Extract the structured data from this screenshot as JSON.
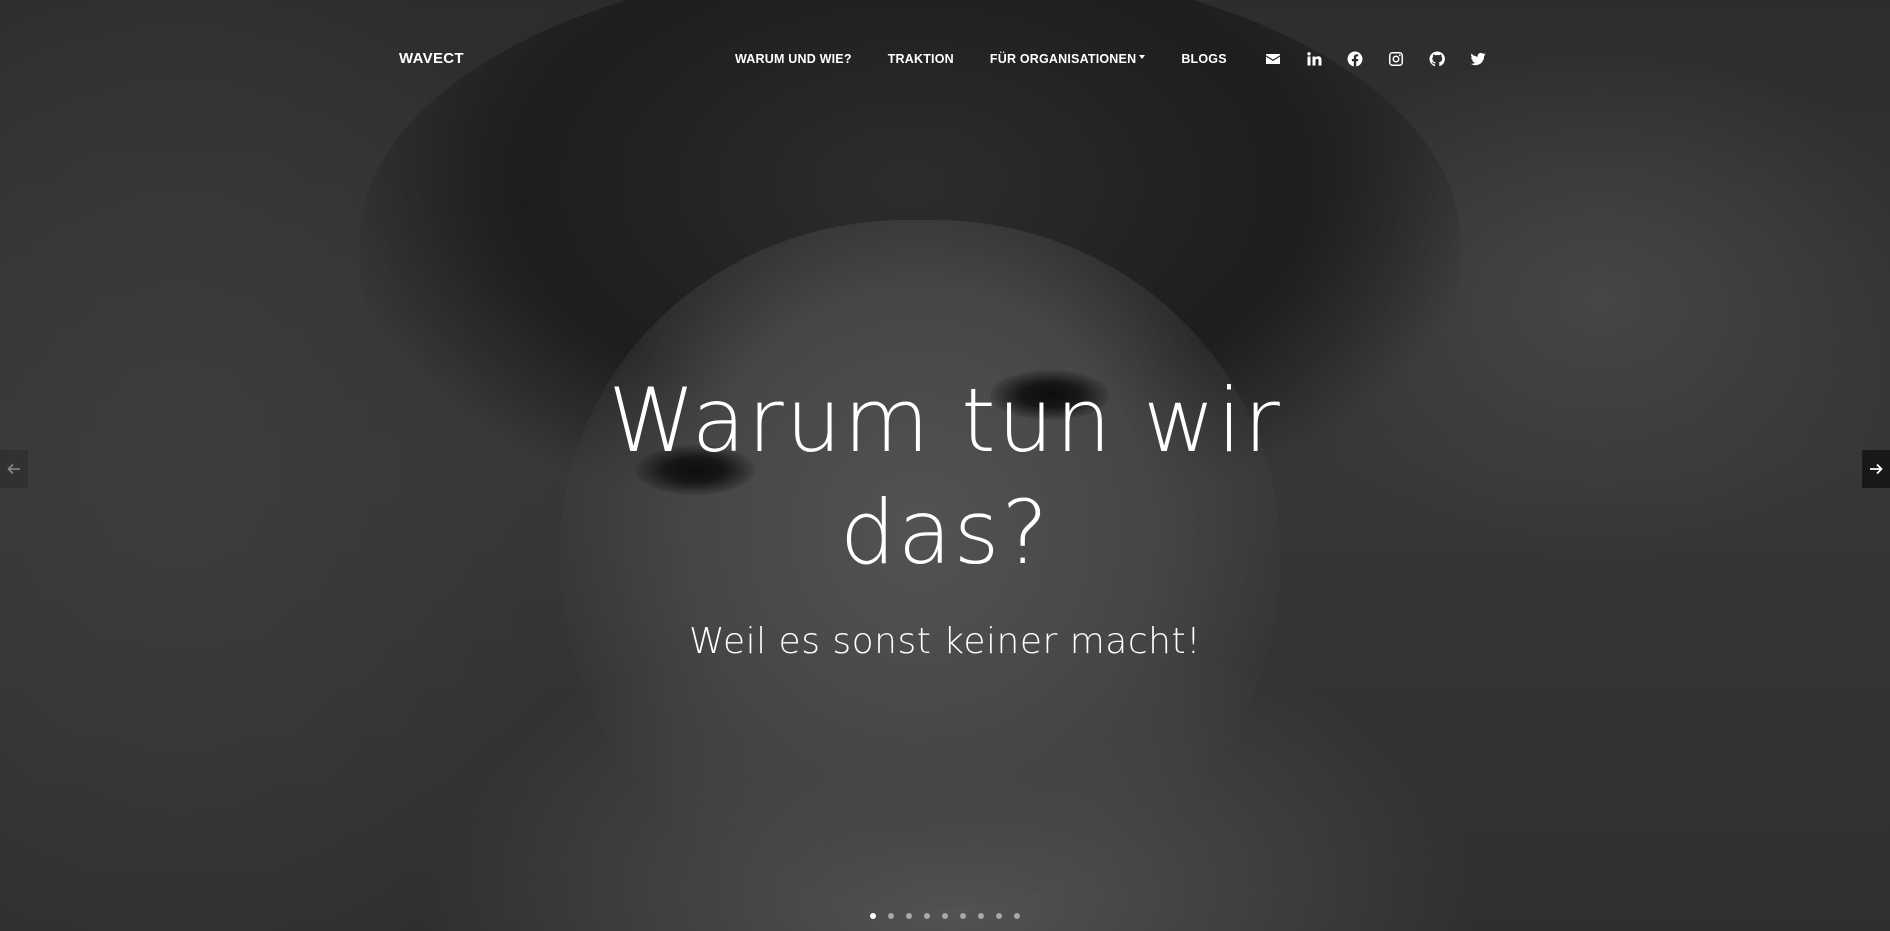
{
  "navbar": {
    "brand": "WAVECT",
    "links": [
      {
        "label": "WARUM UND WIE?"
      },
      {
        "label": "TRAKTION"
      },
      {
        "label": "FÜR ORGANISATIONEN",
        "dropdown": true
      },
      {
        "label": "BLOGS"
      }
    ],
    "social_icons": [
      "envelope-icon",
      "linkedin-icon",
      "facebook-icon",
      "instagram-icon",
      "github-icon",
      "twitter-icon"
    ]
  },
  "carousel": {
    "headline": "Warum tun wir das?",
    "subline": "Weil es sonst keiner macht!",
    "slide_count": 9,
    "active_slide": 1,
    "prev_icon": "arrow-left-icon",
    "next_icon": "arrow-right-icon"
  },
  "colors": {
    "text": "#ffffff",
    "overlay": "#000000"
  }
}
